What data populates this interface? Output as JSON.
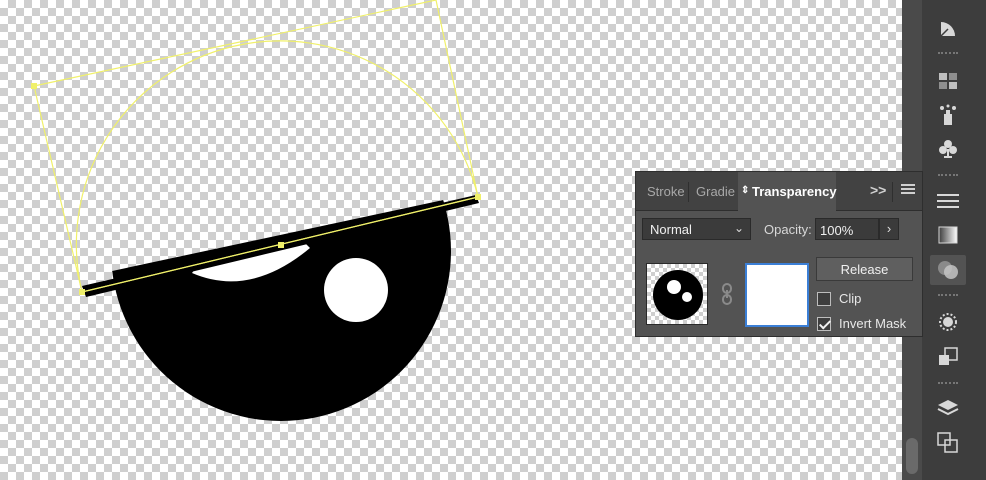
{
  "panel": {
    "tabs": [
      {
        "label": "Stroke",
        "active": false
      },
      {
        "label": "Gradie",
        "active": false
      },
      {
        "label": "Transparency",
        "active": true
      }
    ],
    "collapse_glyph": ">>",
    "blend_mode": {
      "selected": "Normal"
    },
    "opacity": {
      "label": "Opacity:",
      "value": "100%"
    },
    "release_label": "Release",
    "clip": {
      "label": "Clip",
      "checked": false
    },
    "invert_mask": {
      "label": "Invert Mask",
      "checked": true
    }
  },
  "tools": [
    "pie-chart-icon",
    "swatch-grid-icon",
    "symbol-sprayer-icon",
    "club-icon",
    "stroke-lines-icon",
    "gradient-icon",
    "transparency-icon",
    "appearance-icon",
    "graphic-styles-icon",
    "layers-icon",
    "artboards-icon"
  ],
  "colors": {
    "selection": "#f0f06a",
    "panel_bg": "#535353",
    "mask_highlight": "#3b7fd6"
  }
}
